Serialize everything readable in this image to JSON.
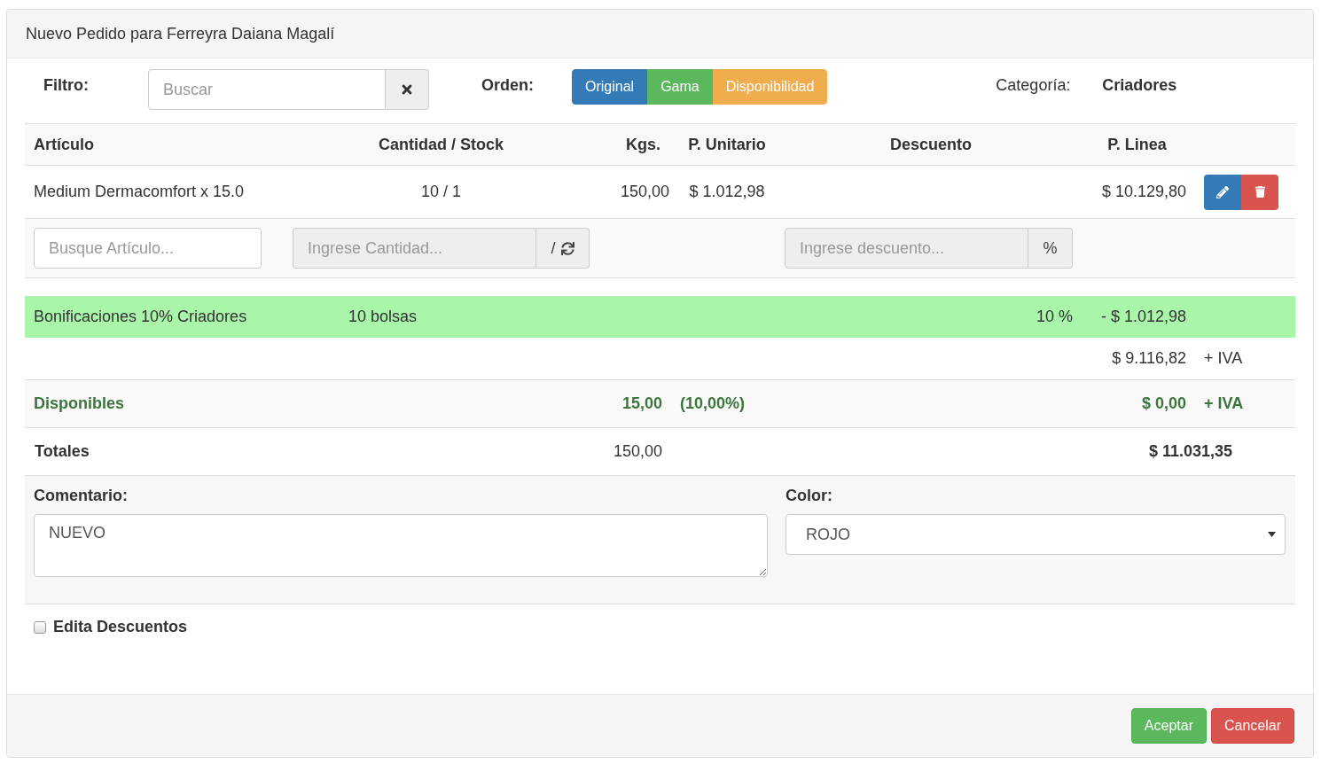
{
  "modal": {
    "title": "Nuevo Pedido para Ferreyra Daiana Magalí"
  },
  "filter": {
    "label": "Filtro:",
    "placeholder": "Buscar"
  },
  "order": {
    "label": "Orden:",
    "options": [
      {
        "label": "Original",
        "color": "#337ab7"
      },
      {
        "label": "Gama",
        "color": "#5cb85c"
      },
      {
        "label": "Disponibilidad",
        "color": "#f0ad4e"
      }
    ]
  },
  "category": {
    "label": "Categoría:",
    "value": "Criadores"
  },
  "table": {
    "columns": [
      "Artículo",
      "Cantidad / Stock",
      "Kgs.",
      "P. Unitario",
      "Descuento",
      "P. Linea"
    ],
    "rows": [
      {
        "article": "Medium Dermacomfort x 15.0",
        "quantity_stock": "10 / 1",
        "kgs": "150,00",
        "unit_price": "$ 1.012,98",
        "line_price": "$ 10.129,80"
      }
    ]
  },
  "entry": {
    "article_placeholder": "Busque Artículo...",
    "quantity_placeholder": "Ingrese Cantidad...",
    "quantity_addon": "/",
    "quantity_disabled": true,
    "discount_placeholder": "Ingrese descuento...",
    "discount_addon": "%",
    "discount_disabled": true
  },
  "bonus": {
    "name": "Bonificaciones 10% Criadores",
    "quantity": "10 bolsas",
    "percent": "10 %",
    "amount": "- $ 1.012,98"
  },
  "subtotal": {
    "amount": "$ 9.116,82",
    "tax": "+ IVA"
  },
  "available": {
    "label": "Disponibles",
    "kgs": "15,00",
    "percent": "(10,00%)",
    "amount": "$ 0,00",
    "tax": "+ IVA"
  },
  "totals": {
    "label": "Totales",
    "kgs": "150,00",
    "amount": "$ 11.031,35"
  },
  "comment": {
    "label": "Comentario:",
    "value": "NUEVO"
  },
  "color": {
    "label": "Color:",
    "value": "ROJO"
  },
  "edit_discounts": {
    "label": "Edita Descuentos",
    "checked": false
  },
  "buttons": [
    {
      "label": "Aceptar",
      "kind": "primary"
    },
    {
      "label": "Cancelar",
      "kind": "danger"
    }
  ]
}
